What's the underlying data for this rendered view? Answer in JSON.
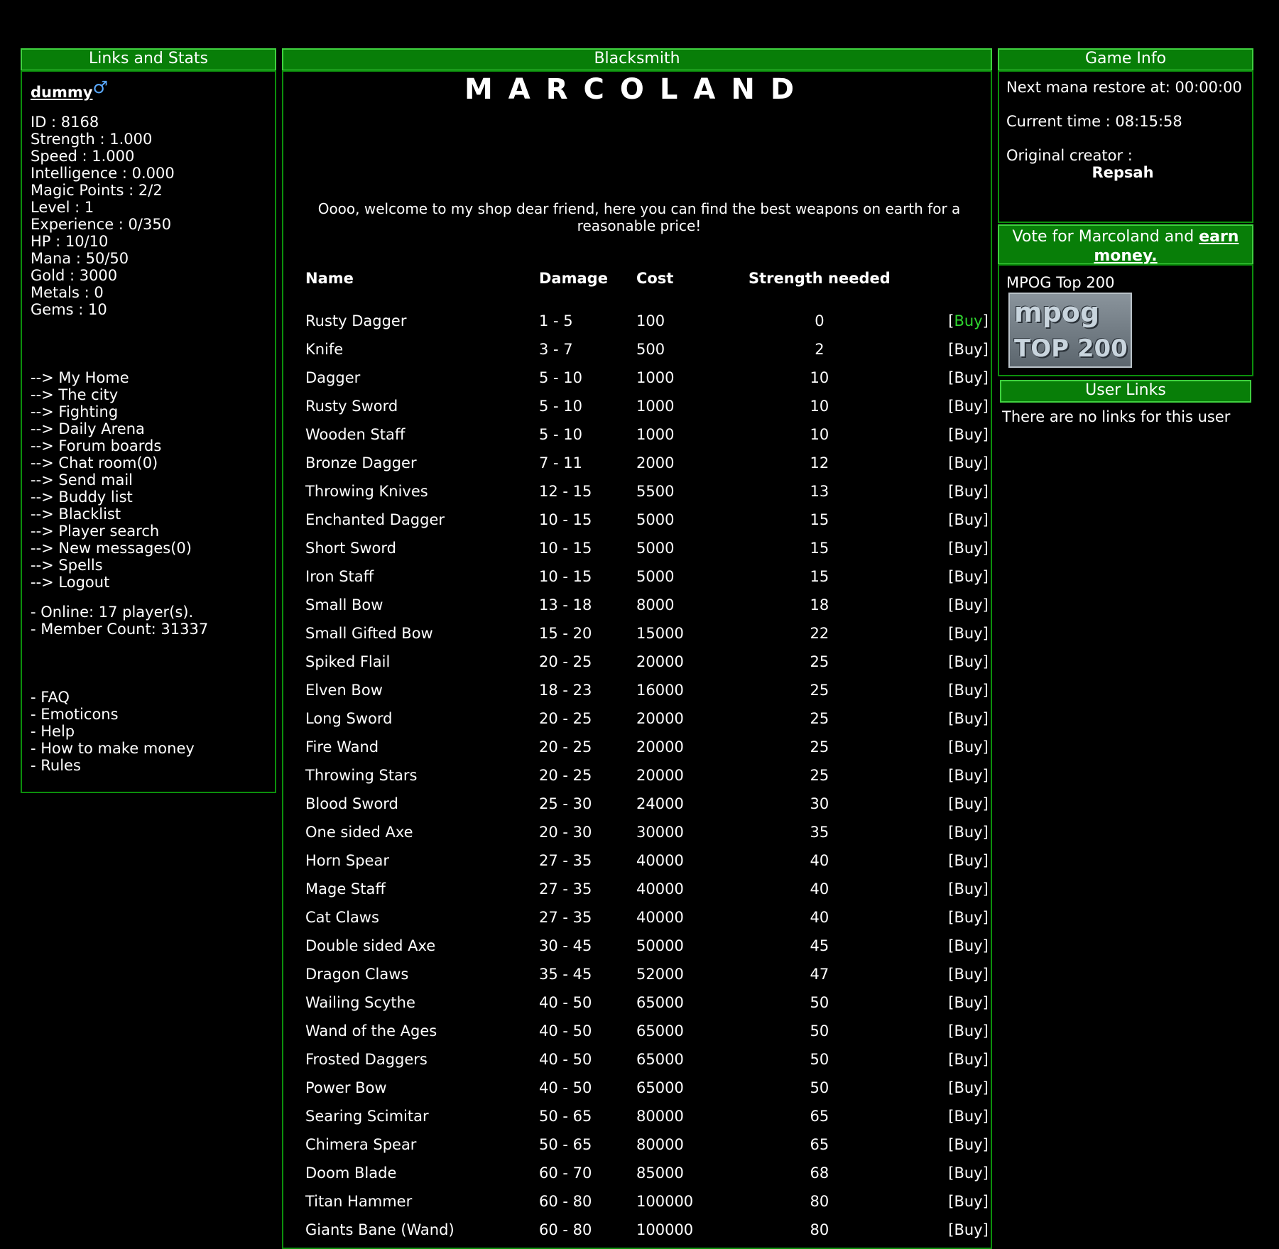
{
  "left": {
    "header": "Links and Stats",
    "username": "dummy",
    "gender_symbol": "♂",
    "stats": [
      "ID : 8168",
      "Strength : 1.000",
      "Speed : 1.000",
      "Intelligence : 0.000",
      "Magic Points : 2/2",
      "Level : 1",
      "Experience : 0/350",
      "HP : 10/10",
      "Mana : 50/50",
      "Gold : 3000",
      "Metals : 0",
      "Gems : 10"
    ],
    "nav": [
      "--> My Home",
      "--> The city",
      "--> Fighting",
      "--> Daily Arena",
      "--> Forum boards",
      "--> Chat room(0)",
      "--> Send mail",
      "--> Buddy list",
      "--> Blacklist",
      "--> Player search",
      "--> New messages(0)",
      "--> Spells",
      "--> Logout"
    ],
    "online": "- Online: 17 player(s).",
    "members": "- Member Count: 31337",
    "help_links": [
      "- FAQ",
      "- Emoticons",
      "- Help",
      "- How to make money",
      "- Rules"
    ]
  },
  "center": {
    "header": "Blacksmith",
    "logo": "MARCOLAND",
    "welcome": "Oooo, welcome to my shop dear friend, here you can find the best weapons on earth for a reasonable price!",
    "columns": [
      "Name",
      "Damage",
      "Cost",
      "Strength needed"
    ],
    "buy_label": "Buy",
    "items": [
      [
        "Rusty Dagger",
        "1 - 5",
        "100",
        "0"
      ],
      [
        "Knife",
        "3 - 7",
        "500",
        "2"
      ],
      [
        "Dagger",
        "5 - 10",
        "1000",
        "10"
      ],
      [
        "Rusty Sword",
        "5 - 10",
        "1000",
        "10"
      ],
      [
        "Wooden Staff",
        "5 - 10",
        "1000",
        "10"
      ],
      [
        "Bronze Dagger",
        "7 - 11",
        "2000",
        "12"
      ],
      [
        "Throwing Knives",
        "12 - 15",
        "5500",
        "13"
      ],
      [
        "Enchanted Dagger",
        "10 - 15",
        "5000",
        "15"
      ],
      [
        "Short Sword",
        "10 - 15",
        "5000",
        "15"
      ],
      [
        "Iron Staff",
        "10 - 15",
        "5000",
        "15"
      ],
      [
        "Small Bow",
        "13 - 18",
        "8000",
        "18"
      ],
      [
        "Small Gifted Bow",
        "15 - 20",
        "15000",
        "22"
      ],
      [
        "Spiked Flail",
        "20 - 25",
        "20000",
        "25"
      ],
      [
        "Elven Bow",
        "18 - 23",
        "16000",
        "25"
      ],
      [
        "Long Sword",
        "20 - 25",
        "20000",
        "25"
      ],
      [
        "Fire Wand",
        "20 - 25",
        "20000",
        "25"
      ],
      [
        "Throwing Stars",
        "20 - 25",
        "20000",
        "25"
      ],
      [
        "Blood Sword",
        "25 - 30",
        "24000",
        "30"
      ],
      [
        "One sided Axe",
        "20 - 30",
        "30000",
        "35"
      ],
      [
        "Horn Spear",
        "27 - 35",
        "40000",
        "40"
      ],
      [
        "Mage Staff",
        "27 - 35",
        "40000",
        "40"
      ],
      [
        "Cat Claws",
        "27 - 35",
        "40000",
        "40"
      ],
      [
        "Double sided Axe",
        "30 - 45",
        "50000",
        "45"
      ],
      [
        "Dragon Claws",
        "35 - 45",
        "52000",
        "47"
      ],
      [
        "Wailing Scythe",
        "40 - 50",
        "65000",
        "50"
      ],
      [
        "Wand of the Ages",
        "40 - 50",
        "65000",
        "50"
      ],
      [
        "Frosted Daggers",
        "40 - 50",
        "65000",
        "50"
      ],
      [
        "Power Bow",
        "40 - 50",
        "65000",
        "50"
      ],
      [
        "Searing Scimitar",
        "50 - 65",
        "80000",
        "65"
      ],
      [
        "Chimera Spear",
        "50 - 65",
        "80000",
        "65"
      ],
      [
        "Doom Blade",
        "60 - 70",
        "85000",
        "68"
      ],
      [
        "Titan Hammer",
        "60 - 80",
        "100000",
        "80"
      ],
      [
        "Giants Bane (Wand)",
        "60 - 80",
        "100000",
        "80"
      ]
    ]
  },
  "right": {
    "header": "Game Info",
    "mana_restore": "Next mana restore at: 00:00:00",
    "current_time": "Current time : 08:15:58",
    "creator_label": "Original creator :",
    "creator_name": "Repsah",
    "vote_text": "Vote for Marcoland and ",
    "vote_link": "earn money.",
    "mpog_label": "MPOG Top 200",
    "mpog_badge_line1": "mpog",
    "mpog_badge_line2": "TOP 200",
    "user_links_header": "User Links",
    "user_links_text": "There are no links for this user"
  },
  "colors": {
    "header_bg": "#087e08",
    "header_border": "#3fd13f",
    "panel_border": "#0c8f0c",
    "first_buy": "#2fd62f"
  }
}
